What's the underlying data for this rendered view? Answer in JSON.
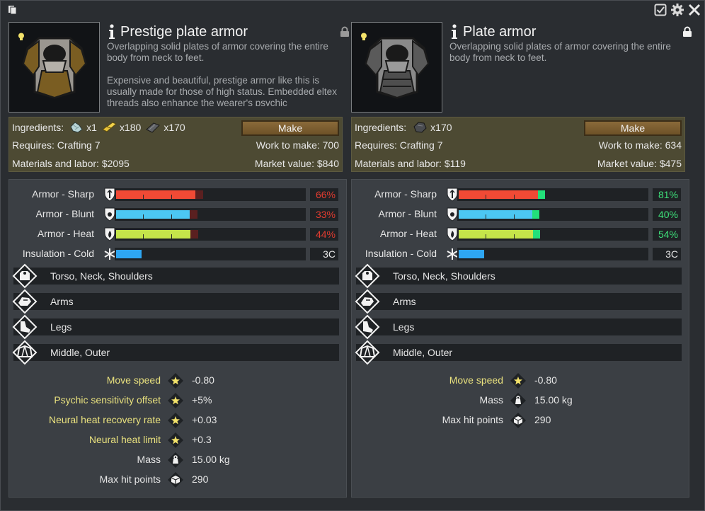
{
  "colors": {
    "sharp": "#f04a35",
    "blunt": "#4cc7f2",
    "heat": "#c5e54a",
    "cold": "#2ea6f2",
    "penalty": "#5a2020",
    "bonus": "#22e07a"
  },
  "panels": [
    {
      "title": "Prestige plate armor",
      "description": [
        "Overlapping solid plates of armor covering the entire body from neck to feet.",
        "Expensive and beautiful, prestige armor like this is usually made for those of high status. Embedded eltex threads also enhance the wearer's psychic"
      ],
      "ingredients_label": "Ingredients:",
      "ingredients": [
        {
          "icon": "cloth-icon",
          "qty": "x1"
        },
        {
          "icon": "gold-icon",
          "qty": "x180"
        },
        {
          "icon": "plasteel-icon",
          "qty": "x170"
        }
      ],
      "make_label": "Make",
      "requires": "Requires: Crafting 7",
      "work": "Work to make: 700",
      "materials": "Materials and labor: $2095",
      "market": "Market value: $840",
      "armor": [
        {
          "label": "Armor - Sharp",
          "value": "66%",
          "fill": 0.66,
          "base": 0.78,
          "kind": "sharp"
        },
        {
          "label": "Armor - Blunt",
          "value": "33%",
          "fill": 0.61,
          "base": 0.65,
          "kind": "blunt"
        },
        {
          "label": "Armor - Heat",
          "value": "44%",
          "fill": 0.62,
          "base": 0.66,
          "kind": "heat"
        },
        {
          "label": "Insulation - Cold",
          "value": "3C",
          "fill": 0.14,
          "base": 0.14,
          "kind": "cold"
        }
      ],
      "coverage": [
        "Torso, Neck, Shoulders",
        "Arms",
        "Legs",
        "Middle, Outer"
      ],
      "stats": [
        {
          "label": "Move speed",
          "value": "-0.80",
          "icon": "star-icon",
          "tone": "yellow"
        },
        {
          "label": "Psychic sensitivity offset",
          "value": "+5%",
          "icon": "star-icon",
          "tone": "yellow"
        },
        {
          "label": "Neural heat recovery rate",
          "value": "+0.03",
          "icon": "star-icon",
          "tone": "yellow"
        },
        {
          "label": "Neural heat limit",
          "value": "+0.3",
          "icon": "star-icon",
          "tone": "yellow"
        },
        {
          "label": "Mass",
          "value": "15.00 kg",
          "icon": "weight-icon",
          "tone": "white"
        },
        {
          "label": "Max hit points",
          "value": "290",
          "icon": "hitpoints-icon",
          "tone": "white"
        }
      ]
    },
    {
      "title": "Plate armor",
      "description": [
        "Overlapping solid plates of armor covering the entire body from neck to feet."
      ],
      "ingredients_label": "Ingredients:",
      "ingredients": [
        {
          "icon": "steel-icon",
          "qty": "x170"
        }
      ],
      "make_label": "Make",
      "requires": "Requires: Crafting 7",
      "work": "Work to make: 634",
      "materials": "Materials and labor: $119",
      "market": "Market value: $475",
      "armor": [
        {
          "label": "Armor - Sharp",
          "value": "81%",
          "fill": 0.66,
          "base": 0.7,
          "kind": "sharp"
        },
        {
          "label": "Armor - Blunt",
          "value": "40%",
          "fill": 0.61,
          "base": 0.65,
          "kind": "blunt"
        },
        {
          "label": "Armor - Heat",
          "value": "54%",
          "fill": 0.62,
          "base": 0.66,
          "kind": "heat"
        },
        {
          "label": "Insulation - Cold",
          "value": "3C",
          "fill": 0.14,
          "base": 0.14,
          "kind": "cold"
        }
      ],
      "coverage": [
        "Torso, Neck, Shoulders",
        "Arms",
        "Legs",
        "Middle, Outer"
      ],
      "stats": [
        {
          "label": "Move speed",
          "value": "-0.80",
          "icon": "star-icon",
          "tone": "yellow"
        },
        {
          "label": "Mass",
          "value": "15.00 kg",
          "icon": "weight-icon",
          "tone": "white"
        },
        {
          "label": "Max hit points",
          "value": "290",
          "icon": "hitpoints-icon",
          "tone": "white"
        }
      ]
    }
  ]
}
